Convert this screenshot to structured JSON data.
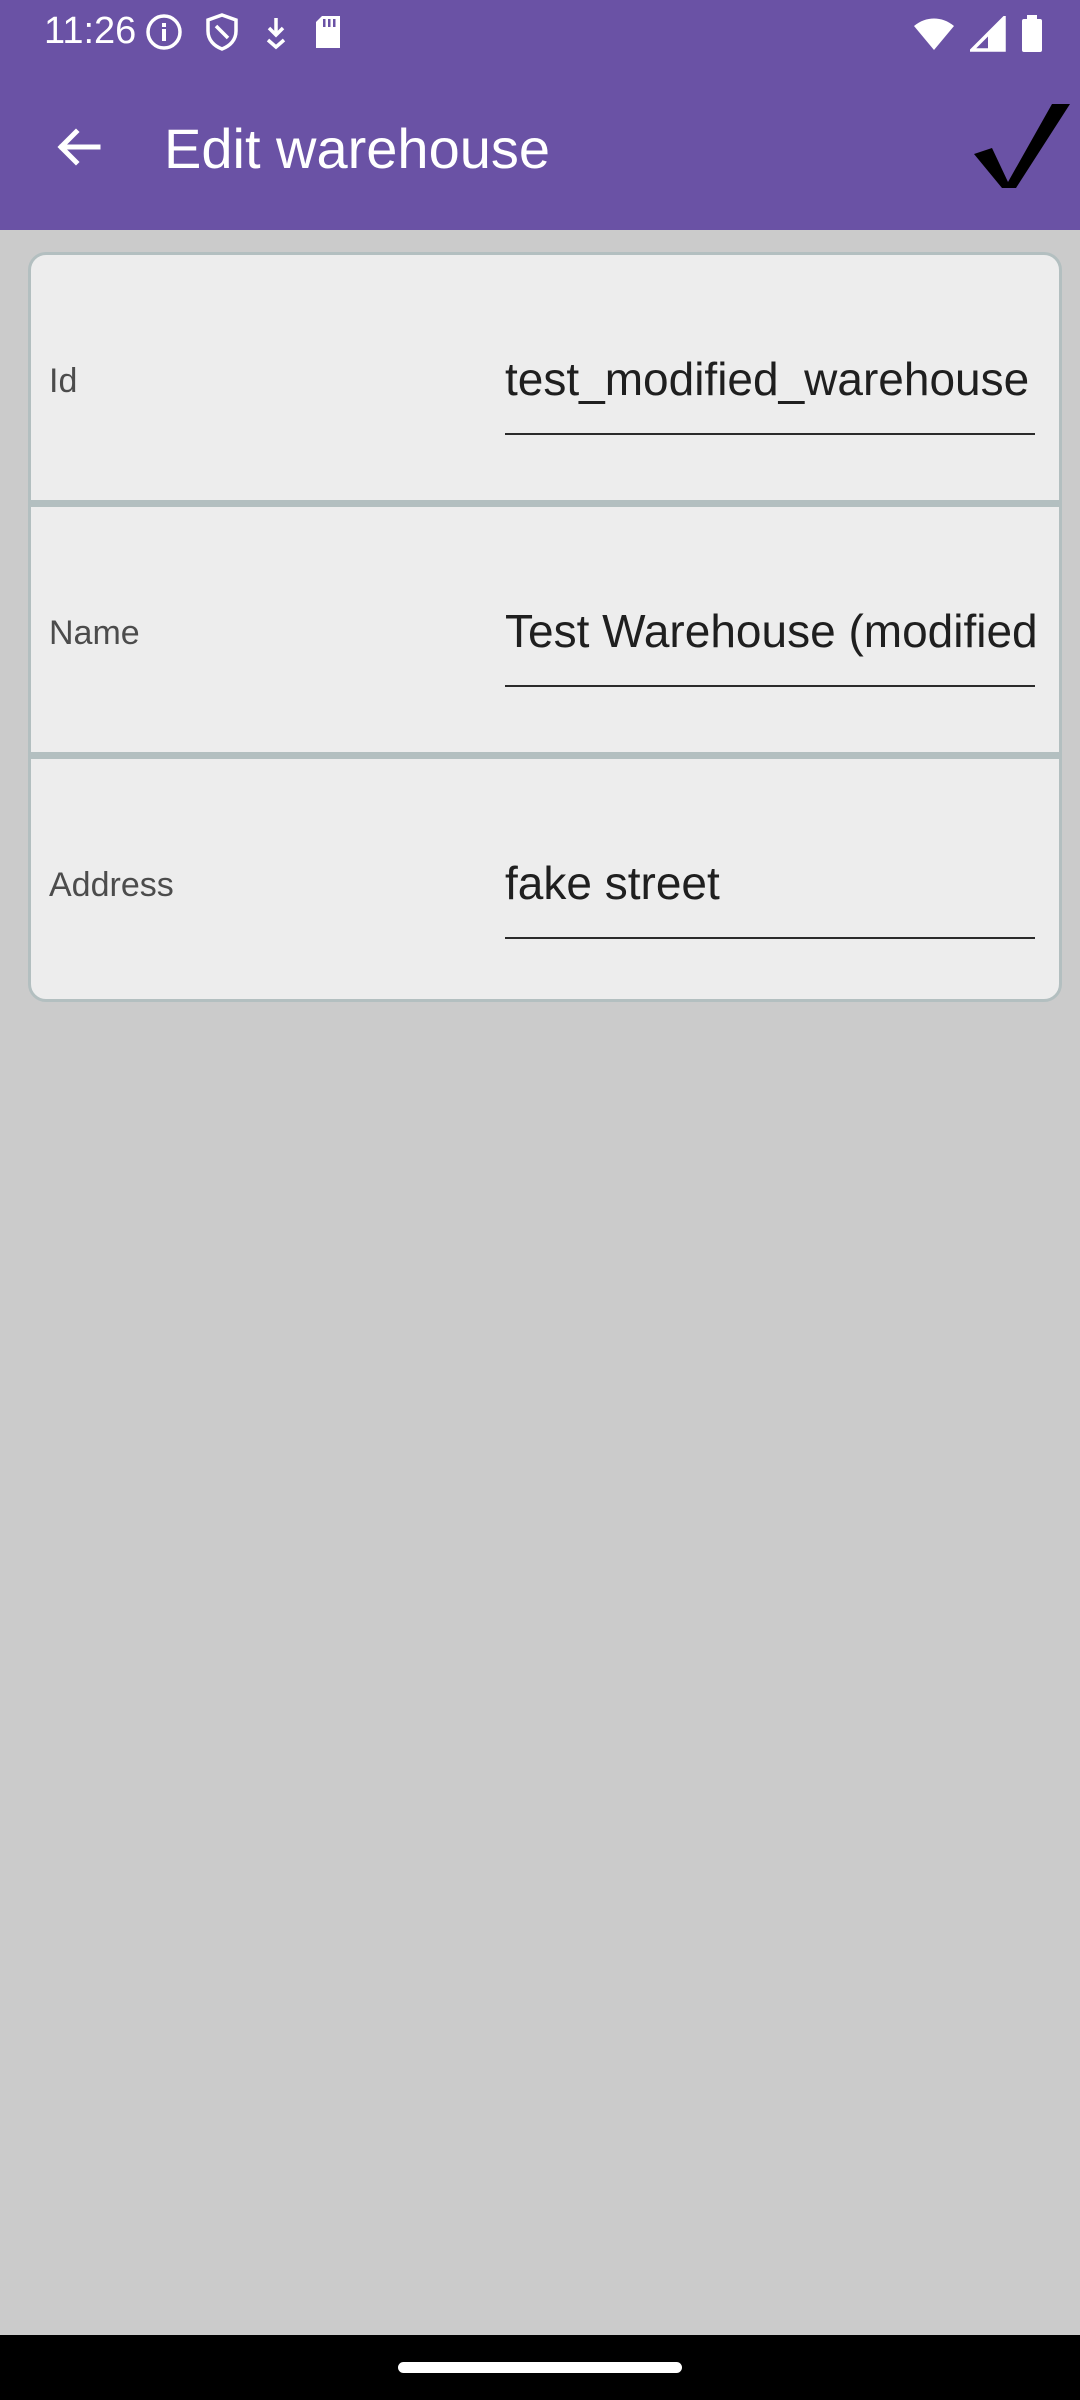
{
  "status_bar": {
    "time": "11:26",
    "left_icons": [
      "info-icon",
      "shield-icon",
      "download-icon",
      "sd-card-icon"
    ],
    "right_icons": [
      "wifi-icon",
      "signal-icon",
      "battery-icon"
    ]
  },
  "toolbar": {
    "title": "Edit warehouse",
    "back_icon": "arrow-left-icon",
    "save_icon": "checkmark-icon"
  },
  "form": {
    "fields": [
      {
        "label": "Id",
        "value": "test_modified_warehouse"
      },
      {
        "label": "Name",
        "value": "Test Warehouse (modified)"
      },
      {
        "label": "Address",
        "value": "fake street"
      }
    ]
  },
  "colors": {
    "app_bar": "#6a52a5",
    "background": "#cbcbcb",
    "card": "#ededed",
    "divider": "#b3bfc0"
  }
}
